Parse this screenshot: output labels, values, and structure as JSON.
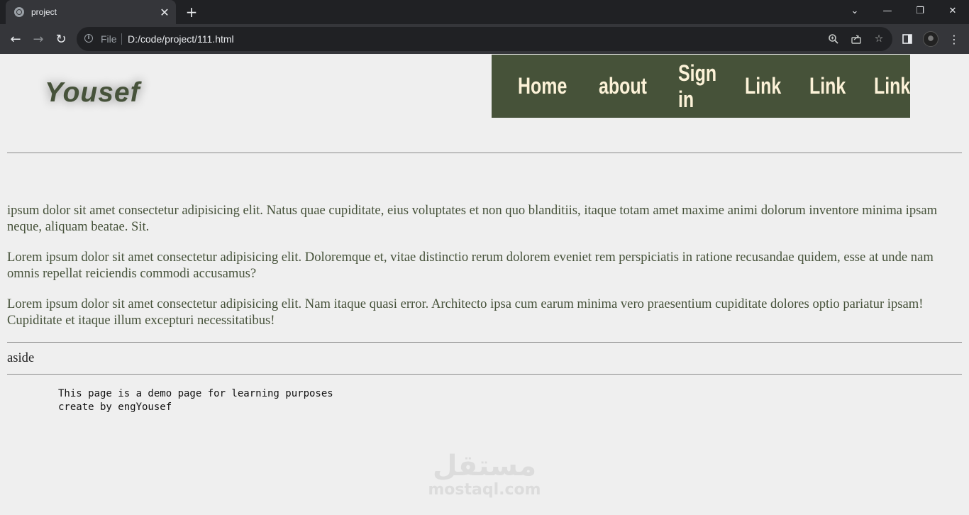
{
  "browser": {
    "tab_title": "project",
    "tab_close": "✕",
    "new_tab": "+",
    "address": {
      "scheme_label": "File",
      "url": "D:/code/project/111.html"
    },
    "icons": {
      "back": "back-arrow-icon",
      "forward": "forward-arrow-icon",
      "reload": "reload-icon",
      "zoom": "zoom-icon",
      "share": "share-icon",
      "bookmark": "star-icon",
      "side_panel": "side-panel-icon",
      "menu": "kebab-menu-icon"
    }
  },
  "site": {
    "logo": "Yousef",
    "nav": [
      "Home",
      "about",
      "Sign in",
      "Link",
      "Link",
      "Link"
    ],
    "paragraphs": [
      "ipsum dolor sit amet consectetur adipisicing elit. Natus quae cupiditate, eius voluptates et non quo blanditiis, itaque totam amet maxime animi dolorum inventore minima ipsam neque, aliquam beatae. Sit.",
      "Lorem ipsum dolor sit amet consectetur adipisicing elit. Doloremque et, vitae distinctio rerum dolorem eveniet rem perspiciatis in ratione recusandae quidem, esse at unde nam omnis repellat reiciendis commodi accusamus?",
      "Lorem ipsum dolor sit amet consectetur adipisicing elit. Nam itaque quasi error. Architecto ipsa cum earum minima vero praesentium cupiditate dolores optio pariatur ipsam! Cupiditate et itaque illum excepturi necessitatibus!"
    ],
    "aside": "aside",
    "footer_lines": [
      "This page is a demo page for learning purposes",
      "create by engYousef"
    ]
  },
  "watermark": {
    "arabic": "مستقل",
    "latin": "mostaql.com"
  },
  "colors": {
    "nav_bg": "#465239",
    "nav_text": "#fcf2d8",
    "text": "#46523a",
    "page_bg": "#efefef"
  }
}
